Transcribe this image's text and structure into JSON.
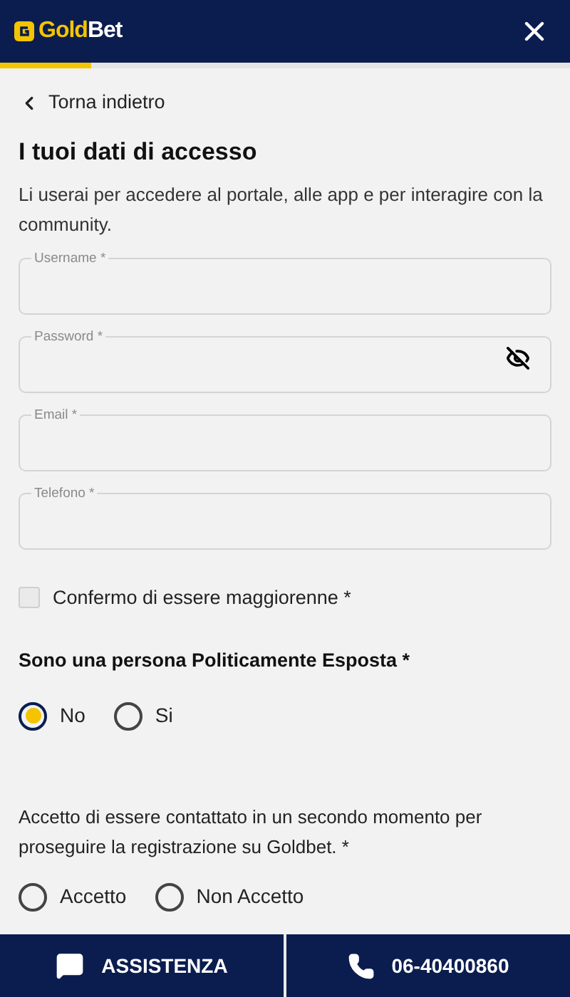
{
  "header": {
    "logo": {
      "part_1": "Gold",
      "part_2": "Bet"
    },
    "progress": {
      "level": 0.16
    }
  },
  "back_link": "Torna indietro",
  "title": "I tuoi dati di accesso",
  "description": "Li userai per accedere al portale, alle app e per interagire con la community.",
  "fields": [
    {
      "label": "Username *",
      "kind": "text"
    },
    {
      "label": "Password *",
      "kind": "password"
    },
    {
      "label": "Email *",
      "kind": "text"
    },
    {
      "label": "Telefono *",
      "kind": "text"
    }
  ],
  "adult_checkbox": {
    "label": "Confermo di essere maggiorenne *",
    "checked": false
  },
  "pep_question": {
    "label": "Sono una persona Politicamente Esposta *",
    "options": [
      {
        "label": "No",
        "selected": true
      },
      {
        "label": "Si",
        "selected": false
      }
    ]
  },
  "contact_question": {
    "label": "Accetto di essere contattato in un secondo momento per proseguire la registrazione su Goldbet. *",
    "options": [
      {
        "label": "Accetto",
        "selected": false
      },
      {
        "label": "Non Accetto",
        "selected": false
      }
    ]
  },
  "bottom_bar": [
    {
      "label": "ASSISTENZA",
      "kind": "chat"
    },
    {
      "label": "06-40400860",
      "kind": "phone"
    }
  ]
}
